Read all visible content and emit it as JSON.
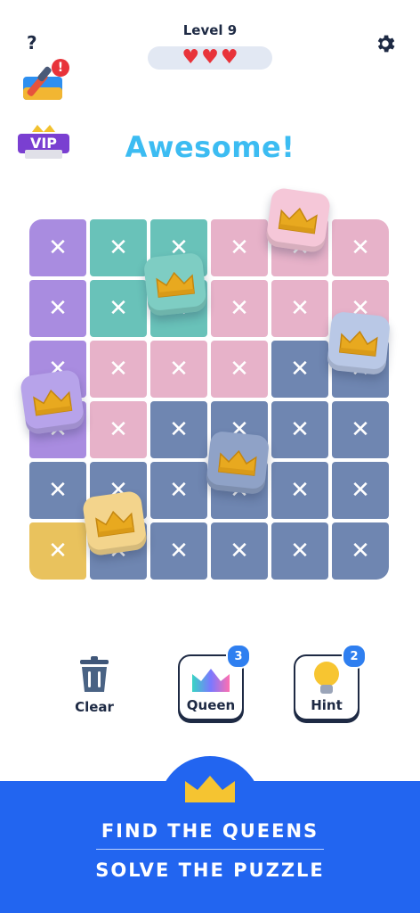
{
  "header": {
    "help_label": "?",
    "level_label": "Level 9",
    "hearts": [
      "♥",
      "♥",
      "♥"
    ],
    "lives_count": 3
  },
  "badges": {
    "vip_label": "VIP",
    "paint_alert": "!"
  },
  "status_message": "Awesome!",
  "board": {
    "size": 6,
    "rows": [
      [
        "purple",
        "teal",
        "teal",
        "pink",
        "pink",
        "pink"
      ],
      [
        "purple",
        "teal",
        "teal",
        "pink",
        "pink",
        "pink"
      ],
      [
        "purple",
        "pink",
        "pink",
        "pink",
        "slate",
        "slate"
      ],
      [
        "purple",
        "pink",
        "slate",
        "slate",
        "slate",
        "slate"
      ],
      [
        "slate",
        "slate",
        "slate",
        "slate",
        "slate",
        "slate"
      ],
      [
        "yellow",
        "slate",
        "slate",
        "slate",
        "slate",
        "slate"
      ]
    ],
    "mark": "✕",
    "queens_placed": [
      {
        "color": "pink",
        "bg": "#f5c7d8"
      },
      {
        "color": "teal",
        "bg": "#7ecdc3"
      },
      {
        "color": "slate",
        "bg": "#b9c8e6"
      },
      {
        "color": "purple",
        "bg": "#b7a3ea"
      },
      {
        "color": "slate",
        "bg": "#8fa2c7"
      },
      {
        "color": "yellow",
        "bg": "#f3d48c"
      }
    ]
  },
  "tools": {
    "clear_label": "Clear",
    "queen_label": "Queen",
    "queen_count": "3",
    "hint_label": "Hint",
    "hint_count": "2"
  },
  "banner": {
    "line1": "FIND THE QUEENS",
    "line2": "SOLVE THE PUZZLE"
  },
  "colors": {
    "purple": "#a98ce0",
    "teal": "#69c2b9",
    "pink": "#e7b2c9",
    "slate": "#6f86b1",
    "yellow": "#e9c25d",
    "accent": "#3cbcf2",
    "banner": "#2265f0",
    "heart": "#e8333a"
  }
}
